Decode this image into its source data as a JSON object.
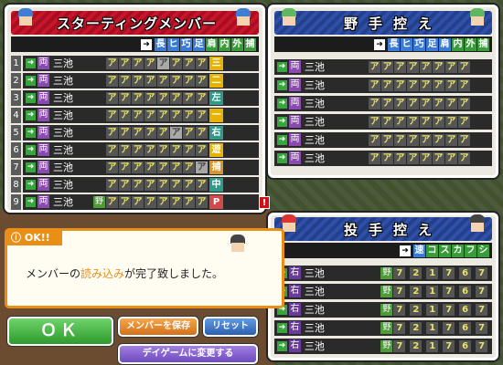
{
  "starting": {
    "title": "スターティングメンバー",
    "headers": [
      "長",
      "ヒ",
      "巧",
      "足",
      "肩",
      "内",
      "外",
      "捕"
    ],
    "header_colors": [
      "#3a7bd5",
      "#3a7bd5",
      "#3a7bd5",
      "#3a7bd5",
      "#3a9b3a",
      "#3a9b3a",
      "#3a9b3a",
      "#3a9b3a"
    ],
    "rows": [
      {
        "num": "1",
        "hand": "両",
        "name": "三池",
        "nozo": "",
        "grades": [
          "ア",
          "ア",
          "ア",
          "ア",
          "ア",
          "ア",
          "ア",
          "ア"
        ],
        "gray": [
          4
        ],
        "pos": "三",
        "pos_color": "#e6b400"
      },
      {
        "num": "2",
        "hand": "両",
        "name": "三池",
        "nozo": "",
        "grades": [
          "ア",
          "ア",
          "ア",
          "ア",
          "ア",
          "ア",
          "ア",
          "ア"
        ],
        "gray": [],
        "pos": "二",
        "pos_color": "#e6b400"
      },
      {
        "num": "3",
        "hand": "両",
        "name": "三池",
        "nozo": "",
        "grades": [
          "ア",
          "ア",
          "ア",
          "ア",
          "ア",
          "ア",
          "ア",
          "ア"
        ],
        "gray": [],
        "pos": "左",
        "pos_color": "#2e9a8a"
      },
      {
        "num": "4",
        "hand": "両",
        "name": "三池",
        "nozo": "",
        "grades": [
          "ア",
          "ア",
          "ア",
          "ア",
          "ア",
          "ア",
          "ア",
          "ア"
        ],
        "gray": [],
        "pos": "一",
        "pos_color": "#e6b400"
      },
      {
        "num": "5",
        "hand": "両",
        "name": "三池",
        "nozo": "",
        "grades": [
          "ア",
          "ア",
          "ア",
          "ア",
          "ア",
          "ア",
          "ア",
          "ア"
        ],
        "gray": [
          5
        ],
        "pos": "右",
        "pos_color": "#2e9a8a"
      },
      {
        "num": "6",
        "hand": "両",
        "name": "三池",
        "nozo": "",
        "grades": [
          "ア",
          "ア",
          "ア",
          "ア",
          "ア",
          "ア",
          "ア",
          "ア"
        ],
        "gray": [],
        "pos": "遊",
        "pos_color": "#e6b400"
      },
      {
        "num": "7",
        "hand": "両",
        "name": "三池",
        "nozo": "",
        "grades": [
          "ア",
          "ア",
          "ア",
          "ア",
          "ア",
          "ア",
          "ア",
          "ア"
        ],
        "gray": [
          7
        ],
        "pos": "捕",
        "pos_color": "#d8962a"
      },
      {
        "num": "8",
        "hand": "両",
        "name": "三池",
        "nozo": "",
        "grades": [
          "ア",
          "ア",
          "ア",
          "ア",
          "ア",
          "ア",
          "ア",
          "ア"
        ],
        "gray": [],
        "pos": "中",
        "pos_color": "#2e9a8a"
      },
      {
        "num": "9",
        "hand": "両",
        "name": "三池",
        "nozo": "野",
        "grades": [
          "ア",
          "ア",
          "ア",
          "ア",
          "ア",
          "ア",
          "ア",
          "ア"
        ],
        "gray": [],
        "pos": "P",
        "pos_color": "#d24a4a"
      }
    ],
    "warning": "!"
  },
  "fielders_bench": {
    "title": "野手控え",
    "headers": [
      "長",
      "ヒ",
      "巧",
      "足",
      "肩",
      "内",
      "外",
      "捕"
    ],
    "rows": [
      {
        "hand": "両",
        "name": "三池",
        "grades": [
          "ア",
          "ア",
          "ア",
          "ア",
          "ア",
          "ア",
          "ア",
          "ア"
        ]
      },
      {
        "hand": "両",
        "name": "三池",
        "grades": [
          "ア",
          "ア",
          "ア",
          "ア",
          "ア",
          "ア",
          "ア",
          "ア"
        ]
      },
      {
        "hand": "両",
        "name": "三池",
        "grades": [
          "ア",
          "ア",
          "ア",
          "ア",
          "ア",
          "ア",
          "ア",
          "ア"
        ]
      },
      {
        "hand": "両",
        "name": "三池",
        "grades": [
          "ア",
          "ア",
          "ア",
          "ア",
          "ア",
          "ア",
          "ア",
          "ア"
        ]
      },
      {
        "hand": "両",
        "name": "三池",
        "grades": [
          "ア",
          "ア",
          "ア",
          "ア",
          "ア",
          "ア",
          "ア",
          "ア"
        ]
      },
      {
        "hand": "両",
        "name": "三池",
        "grades": [
          "ア",
          "ア",
          "ア",
          "ア",
          "ア",
          "ア",
          "ア",
          "ア"
        ]
      }
    ]
  },
  "pitchers_bench": {
    "title": "投手控え",
    "headers": [
      "速",
      "コ",
      "ス",
      "カ",
      "フ",
      "シ"
    ],
    "rows": [
      {
        "hand": "右",
        "name": "三池",
        "nozo": "野",
        "grades": [
          "7",
          "2",
          "1",
          "7",
          "6",
          "7"
        ]
      },
      {
        "hand": "右",
        "name": "三池",
        "nozo": "野",
        "grades": [
          "7",
          "2",
          "1",
          "7",
          "6",
          "7"
        ]
      },
      {
        "hand": "右",
        "name": "三池",
        "nozo": "野",
        "grades": [
          "7",
          "2",
          "1",
          "7",
          "6",
          "7"
        ]
      },
      {
        "hand": "右",
        "name": "三池",
        "nozo": "野",
        "grades": [
          "7",
          "2",
          "1",
          "7",
          "6",
          "7"
        ]
      },
      {
        "hand": "右",
        "name": "三池",
        "nozo": "野",
        "grades": [
          "7",
          "2",
          "1",
          "7",
          "6",
          "7"
        ]
      }
    ]
  },
  "message": {
    "badge": "OK!!",
    "text_before": "メンバーの",
    "text_highlight": "読み込み",
    "text_after": "が完了致しました。"
  },
  "buttons": {
    "ok": "ＯＫ",
    "save": "メンバーを保存",
    "reset": "リセット",
    "day_game": "デイゲームに変更する"
  }
}
